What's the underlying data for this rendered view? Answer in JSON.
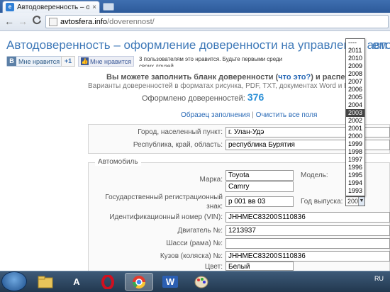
{
  "browser": {
    "tab_title": "Автодоверенность – офор",
    "tab_close": "×",
    "url_host": "avtosfera.info",
    "url_path": "/doverennost/",
    "back": "←",
    "forward": "→",
    "reload": "C"
  },
  "page": {
    "heading": "Автодоверенность – оформление доверенности на управление автом",
    "heading_tail": "ем",
    "vk_like": "Мне нравится",
    "vk_icon": "B",
    "gplus": "+1",
    "fb_like": "Мне нравится",
    "fb_text": "3 пользователям это нравится. Будьте первыми среди своих друзей.",
    "intro_a": "Вы можете заполнить бланк доверенности (",
    "intro_link": "что это?",
    "intro_b": ") и распечат",
    "formats": "Варианты доверенностей в форматах рисунка, PDF, TXT, документах Word и Exce",
    "count_label": "Оформлено доверенностей:",
    "count_value": "376",
    "link_sample": "Образец заполнения",
    "link_sep": "|",
    "link_clear": "Очистить все поля"
  },
  "address": {
    "city_label": "Город, населенный пункт:",
    "city_value": "г. Улан-Удэ",
    "region_label": "Республика, край, область:",
    "region_value": "республика Бурятия"
  },
  "car": {
    "legend": "Автомобиль",
    "make_label": "Марка:",
    "make_value": "Toyota",
    "model_label": "Модель:",
    "model_value": "Camry",
    "plate_label": "Государственный регистрационный знак:",
    "plate_value": "р 001 вв 03",
    "year_label": "Год выпуска:",
    "year_value": "2003",
    "vin_label": "Идентификационный номер (VIN):",
    "vin_value": "JHHMEC83200S110836",
    "engine_label": "Двигатель №:",
    "engine_value": "1213937",
    "chassis_label": "Шасси (рама) №:",
    "chassis_value": "",
    "body_label": "Кузов (коляска) №:",
    "body_value": "JHHMEC83200S110836",
    "color_label": "Цвет:",
    "color_value": "Белый"
  },
  "year_options": [
    "----",
    "2011",
    "2010",
    "2009",
    "2008",
    "2007",
    "2006",
    "2005",
    "2004",
    "2003",
    "2002",
    "2001",
    "2000",
    "1999",
    "1998",
    "1997",
    "1996",
    "1995",
    "1994",
    "1993"
  ],
  "year_selected": "2003",
  "taskbar": {
    "app_word": "W",
    "app_a": "A",
    "lang": "RU"
  },
  "colors": {
    "accent": "#3f79b8",
    "link": "#2a6ab6",
    "count": "#2a8fd6"
  }
}
